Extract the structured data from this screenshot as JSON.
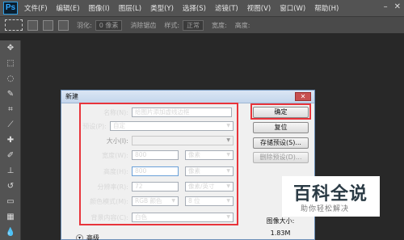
{
  "app": {
    "logo": "Ps"
  },
  "menu": [
    "文件(F)",
    "编辑(E)",
    "图像(I)",
    "图层(L)",
    "类型(Y)",
    "选择(S)",
    "滤镜(T)",
    "视图(V)",
    "窗口(W)",
    "帮助(H)"
  ],
  "options": {
    "feather_label": "羽化:",
    "feather_value": "0 像素",
    "antialias_label": "消除锯齿",
    "style_label": "样式:",
    "style_value": "正常",
    "width_label": "宽度:",
    "height_label": "高度:"
  },
  "dialog": {
    "title": "新建",
    "close": "✕",
    "name_label": "名称(N):",
    "name_value": "给图片添加虚线边框",
    "preset_label": "预设(P):",
    "preset_value": "自定",
    "size_label": "大小(I):",
    "width_label": "宽度(W):",
    "width_value": "800",
    "width_unit": "像素",
    "height_label": "高度(H):",
    "height_value": "800",
    "height_unit": "像素",
    "resolution_label": "分辨率(R):",
    "resolution_value": "72",
    "resolution_unit": "像素/英寸",
    "color_mode_label": "颜色模式(M):",
    "color_mode_value": "RGB 颜色",
    "bit_depth_value": "8 位",
    "background_label": "背景内容(C):",
    "background_value": "白色",
    "ok_button": "确定",
    "reset_button": "复位",
    "save_preset_button": "存储预设(S)...",
    "delete_preset_button": "删除预设(D)...",
    "advanced_label": "高级",
    "image_size_label": "图像大小:",
    "image_size_value": "1.83M"
  },
  "watermark": {
    "title": "百科全说",
    "subtitle": "助你轻松解决"
  },
  "colors": {
    "highlight": "#e8343b",
    "ps_blue": "#31a8ff"
  }
}
